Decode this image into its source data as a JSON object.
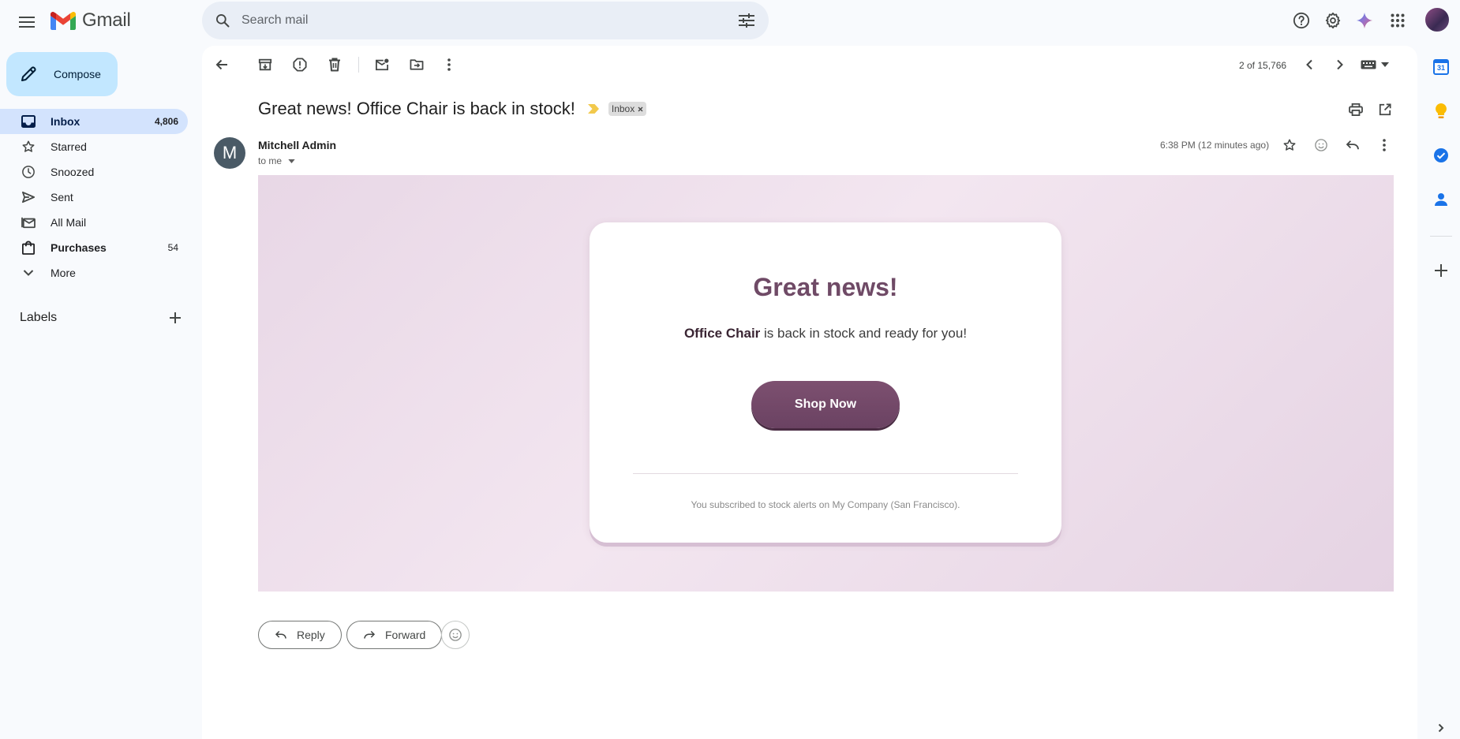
{
  "app": {
    "name": "Gmail"
  },
  "search": {
    "placeholder": "Search mail"
  },
  "compose": {
    "label": "Compose"
  },
  "nav": {
    "items": [
      {
        "label": "Inbox",
        "count": "4,806"
      },
      {
        "label": "Starred",
        "count": ""
      },
      {
        "label": "Snoozed",
        "count": ""
      },
      {
        "label": "Sent",
        "count": ""
      },
      {
        "label": "All Mail",
        "count": ""
      },
      {
        "label": "Purchases",
        "count": "54"
      },
      {
        "label": "More",
        "count": ""
      }
    ]
  },
  "labels": {
    "title": "Labels"
  },
  "toolbar": {
    "pager": "2 of 15,766"
  },
  "message": {
    "subject": "Great news! Office Chair is back in stock!",
    "chip": "Inbox",
    "sender_initial": "M",
    "sender": "Mitchell Admin",
    "to": "to me",
    "time": "6:38 PM (12 minutes ago)"
  },
  "email": {
    "heading": "Great news!",
    "product": "Office Chair",
    "body_rest": " is back in stock and ready for you!",
    "button": "Shop Now",
    "footer": "You subscribed to stock alerts on My Company (San Francisco)."
  },
  "actions": {
    "reply": "Reply",
    "forward": "Forward"
  },
  "side": {
    "calendar_day": "31"
  },
  "colors": {
    "accent": "#0b57d0",
    "nav_active": "#d3e3fd",
    "compose": "#c2e7ff",
    "email_purple": "#6f4a66",
    "important_marker": "#f2c94c"
  }
}
